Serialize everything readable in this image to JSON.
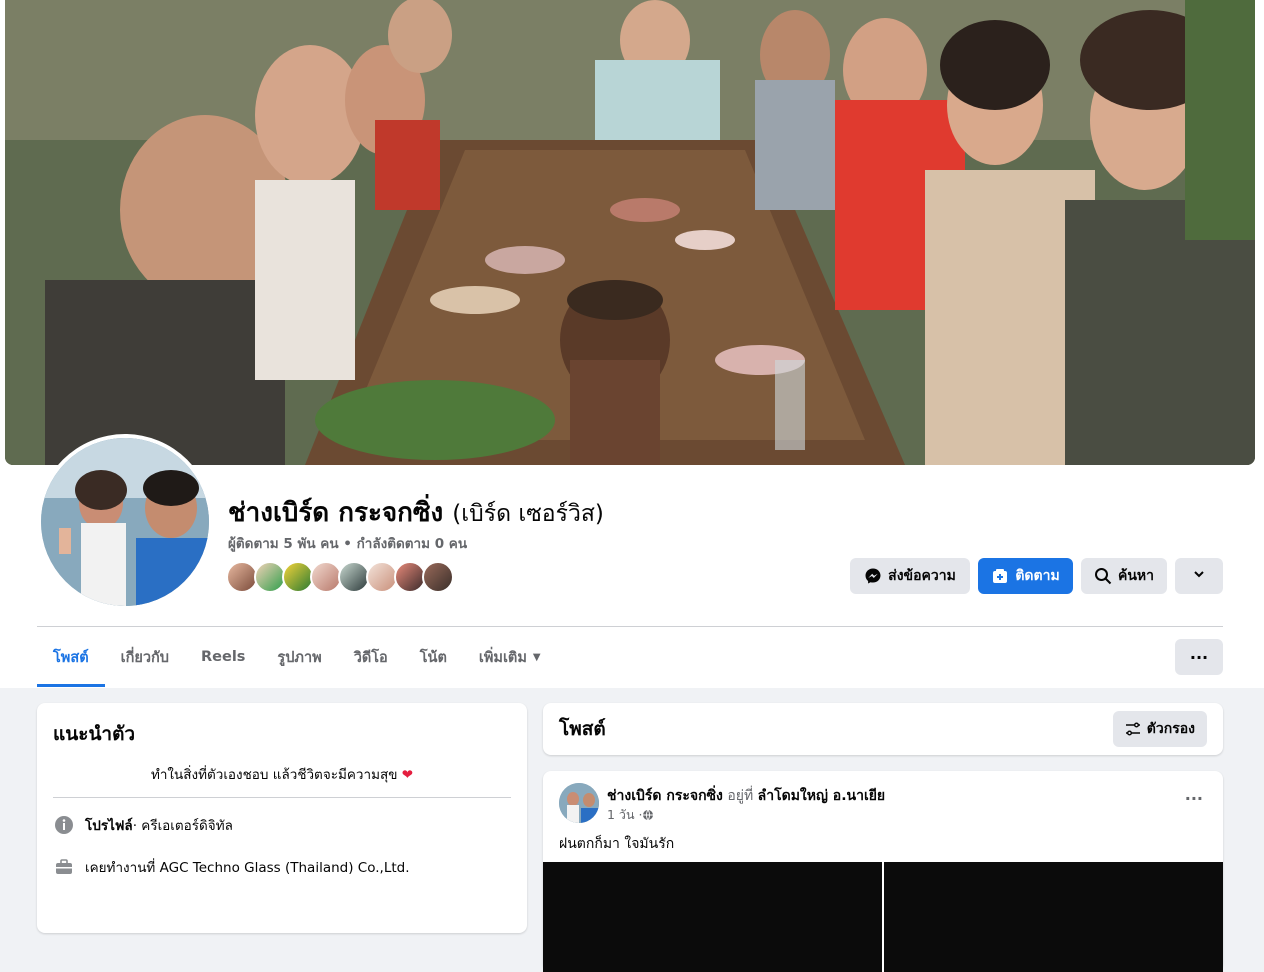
{
  "profile": {
    "name": "ช่างเบิร์ด กระจกซิ่ง",
    "alt_name": "(เบิร์ด เซอร์วิส)",
    "followers_text": "ผู้ติดตาม 5 พัน คน • กำลังติดตาม 0 คน"
  },
  "actions": {
    "message_label": "ส่งข้อความ",
    "follow_label": "ติดตาม",
    "search_label": "ค้นหา"
  },
  "tabs": [
    {
      "label": "โพสต์"
    },
    {
      "label": "เกี่ยวกับ"
    },
    {
      "label": "Reels"
    },
    {
      "label": "รูปภาพ"
    },
    {
      "label": "วิดีโอ"
    },
    {
      "label": "โน้ต"
    },
    {
      "label": "เพิ่มเติม"
    }
  ],
  "intro": {
    "title": "แนะนำตัว",
    "bio": "ทำในสิ่งที่ตัวเองชอบ แล้วชีวิตจะมีความสุข",
    "profile_label": "โปรไฟล์",
    "profile_category": " · ครีเอเตอร์ดิจิทัล",
    "work": "เคยทำงานที่ AGC Techno Glass (Thailand) Co.,Ltd."
  },
  "posts": {
    "title": "โพสต์",
    "filter_label": "ตัวกรอง",
    "items": [
      {
        "author": "ช่างเบิร์ด กระจกซิ่ง",
        "at_word": " อยู่ที่ ",
        "location": "ลำโดมใหญ่ อ.นาเยีย",
        "time": "1 วัน · ",
        "text": "ฝนตกก็มา ใจมันรัก"
      }
    ]
  },
  "colors": {
    "accent": "#1b74e4",
    "page_bg": "#f0f2f5",
    "secondary_text": "#65676b",
    "heart": "#e41e3f"
  },
  "icons": [
    "messenger-icon",
    "follow-plus-icon",
    "search-icon",
    "chevron-down-icon",
    "more-dots-icon",
    "info-icon",
    "briefcase-icon",
    "filter-icon",
    "globe-icon"
  ]
}
